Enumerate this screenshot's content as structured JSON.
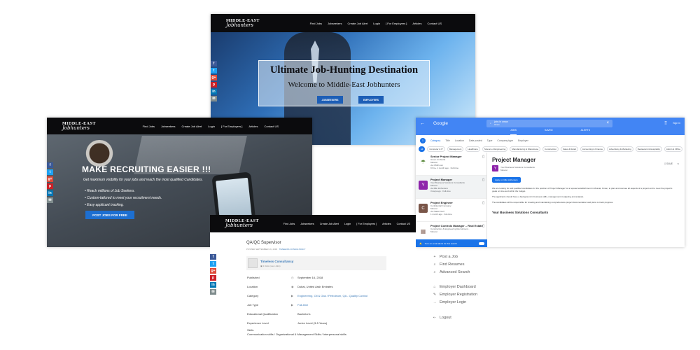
{
  "shot1": {
    "logo_top": "MIDDLE-EAST",
    "logo_bottom": "Jobhunters",
    "menu": [
      "Find Jobs",
      "Jobseekers",
      "Create Job Alert",
      "Login",
      "[ For Employers ]",
      "Articles",
      "Contact US"
    ],
    "headline": "Ultimate Job-Hunting Destination",
    "subheadline": "Welcome to Middle-East Jobhunters",
    "button_jobseekers": "JOBSEEKERS",
    "button_employers": "EMPLOYERS"
  },
  "shot2": {
    "logo_top": "MIDDLE-EAST",
    "logo_bottom": "Jobhunters",
    "menu": [
      "Find Jobs",
      "Jobseekers",
      "Create Job Alert",
      "Login",
      "[ For Employers ]",
      "Articles",
      "Contact US"
    ],
    "title": "MAKE RECRUITING EASIER !!!",
    "subtitle": "Get maximum visibility for your jobs and reach the most qualified Candidates.",
    "bullets": [
      "• Reach millions of Job Seekers.",
      "• Custom-tailored to meet your recruitment needs.",
      "• Easy applicant tracking."
    ],
    "button": "POST JOBS FOR FREE"
  },
  "shot3": {
    "google_label": "Google",
    "search_query": "jobs in oman",
    "search_sub": "Oman",
    "signin": "Sign in",
    "tabs": [
      "JOBS",
      "SAVED",
      "ALERTS"
    ],
    "count": "1",
    "filters": [
      "Category",
      "Title",
      "Location",
      "Date posted",
      "Type",
      "Company type",
      "Employer"
    ],
    "chips": [
      "All",
      "Computer & IT",
      "Management",
      "Healthcare",
      "Science & Engineering",
      "Manufacturing & Warehouse",
      "Construction",
      "Sales & Retail",
      "Accounting & Finance",
      "Advertising & Marketing",
      "Restaurant & Hospitality",
      "Admin & Office"
    ],
    "jobs": [
      {
        "title": "Senior Project Manager",
        "company": "Green Umbrella",
        "location": "Muscat",
        "source": "via OMR.com",
        "meta": "9 hrs+ 1 month ago  ·  Full-time",
        "avatar": "logo",
        "color": "#5c8a3e"
      },
      {
        "title": "Project Manager",
        "company": "Your Business Solutions Consultants",
        "location": "Muscat",
        "source": "via ME Jobhunters",
        "meta": "3 days ago  ·  Full-time",
        "avatar": "Y",
        "color": "#8e24aa"
      },
      {
        "title": "Project Engineer",
        "company": "Confidential Company",
        "location": "Muscat",
        "source": "via Naukri Gulf",
        "meta": "1 month ago  ·  Full-time",
        "avatar": "C",
        "color": "#795548"
      },
      {
        "title": "Project Controls Manager – Real Estate",
        "company": "Construction & Engineering Recruitment...",
        "location": "Muscat",
        "source": "",
        "meta": "",
        "avatar": "logo",
        "color": "#8d6e63"
      }
    ],
    "alert_text": "Turn on email alerts for this search",
    "detail": {
      "title": "Project Manager",
      "company": "Your Business Solutions Consultants",
      "location": "Muscat",
      "apply": "Apply on ME Jobhunters",
      "save": "SAVE",
      "p1": "We are looking for well qualified candidates for the position of Project Manager for a reputed establishment in Muscat, Oman, to plan and oversee all aspects of a project and to meet the project's goals on time and within the budget.",
      "p2": "The applicants should have a background in business skills, management, budgeting and analysis.",
      "p3": "The candidates will be responsible for creating and maintaining comprehensive project documentation and plans to track progress.",
      "section": "Your Business Solutions Consultants"
    }
  },
  "shot4": {
    "logo_top": "MIDDLE-EAST",
    "logo_bottom": "Jobhunters",
    "menu": [
      "Find Jobs",
      "Jobseekers",
      "Create Job Alert",
      "Login",
      "[ For Employers ]",
      "Articles",
      "Contact US"
    ],
    "job_title": "QA/QC Supervisor",
    "posted": "POSTED SEPTEMBER 16, 2018",
    "posted_by": "TIMELESS CONSULTANCY",
    "company": "Timeless Consultancy",
    "view_jobs": "3 Jobs (view Jobs)",
    "rows": [
      {
        "label": "Published",
        "icon": "◷",
        "value": "September 16, 2018",
        "link": false
      },
      {
        "label": "Location",
        "icon": "◉",
        "value": "Dubai, United Arab Emirates",
        "link": false
      },
      {
        "label": "Category",
        "icon": "▶",
        "value": "Engineering,  Oil & Gas / Petroleum,  QA - Quality Control",
        "link": true
      },
      {
        "label": "Job Type",
        "icon": "▶",
        "value": "Full-time",
        "link": true
      },
      {
        "label": "Educational Qualification",
        "icon": "",
        "value": "Bachelor's",
        "link": false
      },
      {
        "label": "Experience Level",
        "icon": "",
        "value": "Junior Level (3-5 Years)",
        "link": false
      }
    ],
    "skills_label": "Skills",
    "skills": "Communication skills / Organizational & Management Skills / Interpersonal skills"
  },
  "sidebar": {
    "group1": [
      {
        "icon": "+",
        "label": "Post a Job"
      },
      {
        "icon": "⌕",
        "label": "Find Resumes"
      },
      {
        "icon": "⌕",
        "label": "Advanced Search"
      }
    ],
    "group2": [
      {
        "icon": "⌂",
        "label": "Employer Dashboard"
      },
      {
        "icon": "✎",
        "label": "Employer Registration"
      },
      {
        "icon": "→",
        "label": "Employer Login"
      }
    ],
    "group3": [
      {
        "icon": "⇠",
        "label": "Logout"
      }
    ]
  }
}
